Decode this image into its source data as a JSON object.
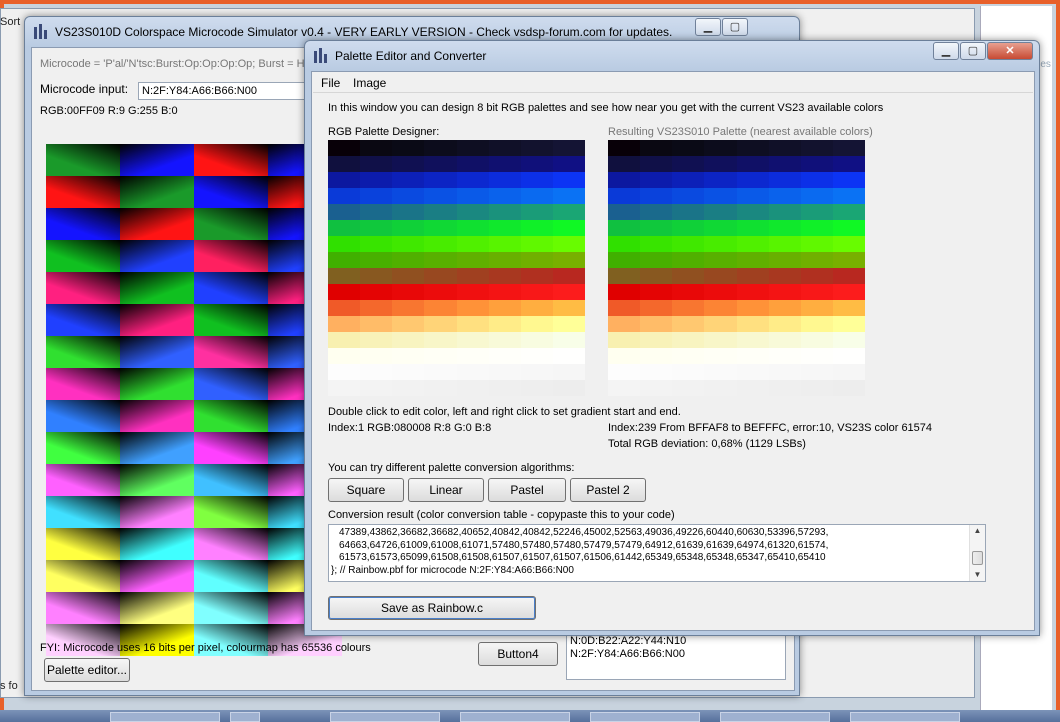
{
  "background": {
    "left_edge_labels": [
      "Sort",
      "s fo"
    ],
    "right_pane_text": "r Preferences"
  },
  "simulator": {
    "title": "VS23S010D Colorspace Microcode Simulator v0.4 - VERY EARLY VERSION - Check vsdsp-forum.com for updates.",
    "info_line": "Microcode = 'P'al/'N'tsc:Burst:Op:Op:Op:Op;   Burst = H",
    "microcode_label": "Microcode input:",
    "microcode_value": "N:2F:Y84:A66:B66:N00",
    "rgb_readout": "RGB:00FF09 R:9 G:255 B:0",
    "fyi": "FYI: Microcode uses 16 bits per pixel, colourmap has 65536 colours",
    "palette_editor_button": "Palette editor...",
    "button4": "Button4",
    "history_lines": [
      "N:0D:B22:A22:Y44:N10",
      "N:2F:Y84:A66:B66:N00"
    ]
  },
  "palette_editor": {
    "title": "Palette Editor and Converter",
    "menu": [
      "File",
      "Image"
    ],
    "intro": "In this window you can design 8 bit RGB palettes and  see how near you get with the current VS23 available colors",
    "designer_label": "RGB Palette Designer:",
    "resulting_label": "Resulting VS23S010 Palette (nearest available colors)",
    "hint": "Double click to edit color, left and right click to set gradient start and end.",
    "index_left": "Index:1 RGB:080008 R:8 G:0 B:8",
    "index_right": "Index:239 From BFFAF8 to BEFFFC, error:10, VS23S color 61574",
    "deviation": "Total RGB deviation: 0,68% (1129 LSBs)",
    "algorithms_label": "You can try different palette conversion algorithms:",
    "algorithm_buttons": [
      "Square",
      "Linear",
      "Pastel",
      "Pastel 2"
    ],
    "conversion_label": "Conversion result (color conversion table - copypaste this to your code)",
    "conversion_lines": [
      "47389,43862,36682,36682,40652,40842,40842,52246,45002,52563,49036,49226,60440,60630,53396,57293,",
      "64663,64726,61009,61008,61071,57480,57480,57480,57479,57479,64912,61639,61639,64974,61320,61574,",
      "61573,61573,65099,61508,61508,61507,61507,61507,61506,61442,65349,65348,65348,65347,65410,65410",
      "};  // Rainbow.pbf for microcode N:2F:Y84:A66:B66:N00"
    ],
    "save_button": "Save as Rainbow.c"
  },
  "colors": {
    "sim_rows": [
      [
        "#1a9a2a",
        "#1414ff",
        "#ff1414",
        "#1414ff"
      ],
      [
        "#ff1414",
        "#1a9a2a",
        "#1414ff",
        "#ff1414"
      ],
      [
        "#1414ff",
        "#ff1414",
        "#1a9a2a",
        "#1414ff"
      ],
      [
        "#10c020",
        "#2040ff",
        "#ff2060",
        "#2040ff"
      ],
      [
        "#ff2080",
        "#10c020",
        "#2040ff",
        "#ff2080"
      ],
      [
        "#2040ff",
        "#ff2080",
        "#10c020",
        "#2040ff"
      ],
      [
        "#30e030",
        "#3060ff",
        "#ff30a0",
        "#3060ff"
      ],
      [
        "#ff30c0",
        "#30e030",
        "#3060ff",
        "#ff30c0"
      ],
      [
        "#3080ff",
        "#ff30c0",
        "#30e030",
        "#3080ff"
      ],
      [
        "#40ff40",
        "#40a0ff",
        "#ff40ff",
        "#40a0ff"
      ],
      [
        "#ff60ff",
        "#60ff60",
        "#40c0ff",
        "#ff60ff"
      ],
      [
        "#40e0ff",
        "#ff80ff",
        "#80ff40",
        "#40e0ff"
      ],
      [
        "#ffff40",
        "#40ffff",
        "#ff80ff",
        "#40ffff"
      ],
      [
        "#ffff60",
        "#ff60ff",
        "#60ffff",
        "#ffff60"
      ],
      [
        "#ff80ff",
        "#ffff80",
        "#80ffff",
        "#ff80ff"
      ],
      [
        "#ffd0ff",
        "#ffff00",
        "#80ffff",
        "#ffd0ff"
      ]
    ],
    "palette_rows": [
      [
        "#080008",
        "#0a0812",
        "#0a0a16",
        "#0c0c1c",
        "#0e0e22",
        "#101028",
        "#12122e",
        "#141434"
      ],
      [
        "#10103e",
        "#101048",
        "#101052",
        "#10105c",
        "#101066",
        "#101070",
        "#10107a",
        "#101084"
      ],
      [
        "#0c18a0",
        "#0c1cac",
        "#0c20b8",
        "#0c24c4",
        "#0c28d0",
        "#0c2cdc",
        "#0c30e8",
        "#0c34f4"
      ],
      [
        "#0a3ad8",
        "#0a42dc",
        "#0a4ae0",
        "#0a52e4",
        "#0a5ae8",
        "#0a62ec",
        "#0a6af0",
        "#0a72f4"
      ],
      [
        "#1a6090",
        "#1a6a8c",
        "#1a7488",
        "#1a7e84",
        "#1a8880",
        "#1a927c",
        "#1a9c78",
        "#1aa674"
      ],
      [
        "#10c040",
        "#10c83c",
        "#10d038",
        "#10d834",
        "#10e030",
        "#10e82c",
        "#10f028",
        "#10f824"
      ],
      [
        "#30e000",
        "#38e400",
        "#40e800",
        "#48ec00",
        "#50f000",
        "#58f400",
        "#60f800",
        "#68fc00"
      ],
      [
        "#40b000",
        "#48b000",
        "#50b000",
        "#58b000",
        "#60b000",
        "#68b000",
        "#70b000",
        "#78b000"
      ],
      [
        "#806020",
        "#885820",
        "#905020",
        "#984820",
        "#a04020",
        "#a83820",
        "#b03020",
        "#b82820"
      ],
      [
        "#e00000",
        "#e40404",
        "#e80808",
        "#ec0c0c",
        "#f01010",
        "#f41414",
        "#f81818",
        "#fc1c1c"
      ],
      [
        "#f05a28",
        "#f4682c",
        "#f87630",
        "#fc8434",
        "#ff9238",
        "#ffa03c",
        "#ffae40",
        "#ffbc44"
      ],
      [
        "#ffb060",
        "#ffbc68",
        "#ffc870",
        "#ffd478",
        "#ffe080",
        "#ffec88",
        "#fff890",
        "#ffff98"
      ],
      [
        "#f8f0b0",
        "#f8f2b8",
        "#f8f4c0",
        "#f8f6c8",
        "#f8f8d0",
        "#f8fad8",
        "#f8fce0",
        "#f8fee8"
      ],
      [
        "#fffff0",
        "#fffff2",
        "#fffff4",
        "#fffff6",
        "#fffff8",
        "#fffffa",
        "#fffffc",
        "#fffffe"
      ],
      [
        "#fdfdfd",
        "#fcfcfc",
        "#fbfbfb",
        "#fafafa",
        "#f9f9f9",
        "#f8f8f8",
        "#f7f7f7",
        "#f6f6f6"
      ],
      [
        "#f4f4f4",
        "#f3f3f3",
        "#f2f2f2",
        "#f1f1f1",
        "#f0f0f0",
        "#efefef",
        "#eeeeee",
        "#ededed"
      ]
    ]
  }
}
